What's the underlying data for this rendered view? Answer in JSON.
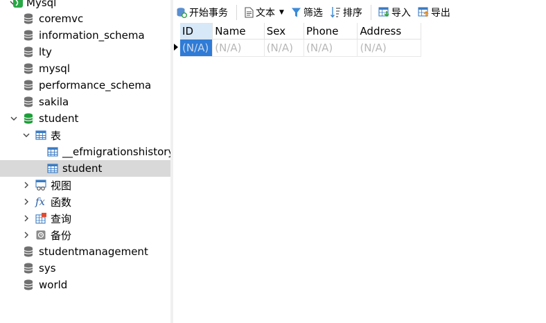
{
  "tree": {
    "root": {
      "label": "Mysql"
    },
    "items": [
      {
        "label": "coremvc"
      },
      {
        "label": "information_schema"
      },
      {
        "label": "lty"
      },
      {
        "label": "mysql"
      },
      {
        "label": "performance_schema"
      },
      {
        "label": "sakila"
      },
      {
        "label": "student"
      },
      {
        "label": "表"
      },
      {
        "label": "__efmigrationshistory"
      },
      {
        "label": "student"
      },
      {
        "label": "视图"
      },
      {
        "label": "函数"
      },
      {
        "label": "查询"
      },
      {
        "label": "备份"
      },
      {
        "label": "studentmanagement"
      },
      {
        "label": "sys"
      },
      {
        "label": "world"
      }
    ]
  },
  "toolbar": {
    "begin_transaction": "开始事务",
    "text": "文本",
    "filter": "筛选",
    "sort": "排序",
    "import": "导入",
    "export": "导出"
  },
  "grid": {
    "columns": [
      "ID",
      "Name",
      "Sex",
      "Phone",
      "Address"
    ],
    "rows": [
      [
        "(N/A)",
        "(N/A)",
        "(N/A)",
        "(N/A)",
        "(N/A)"
      ]
    ]
  },
  "colors": {
    "accent": "#2f7bd6",
    "selected_row": "#d9d9d9",
    "active_db": "#1e9e3a"
  }
}
